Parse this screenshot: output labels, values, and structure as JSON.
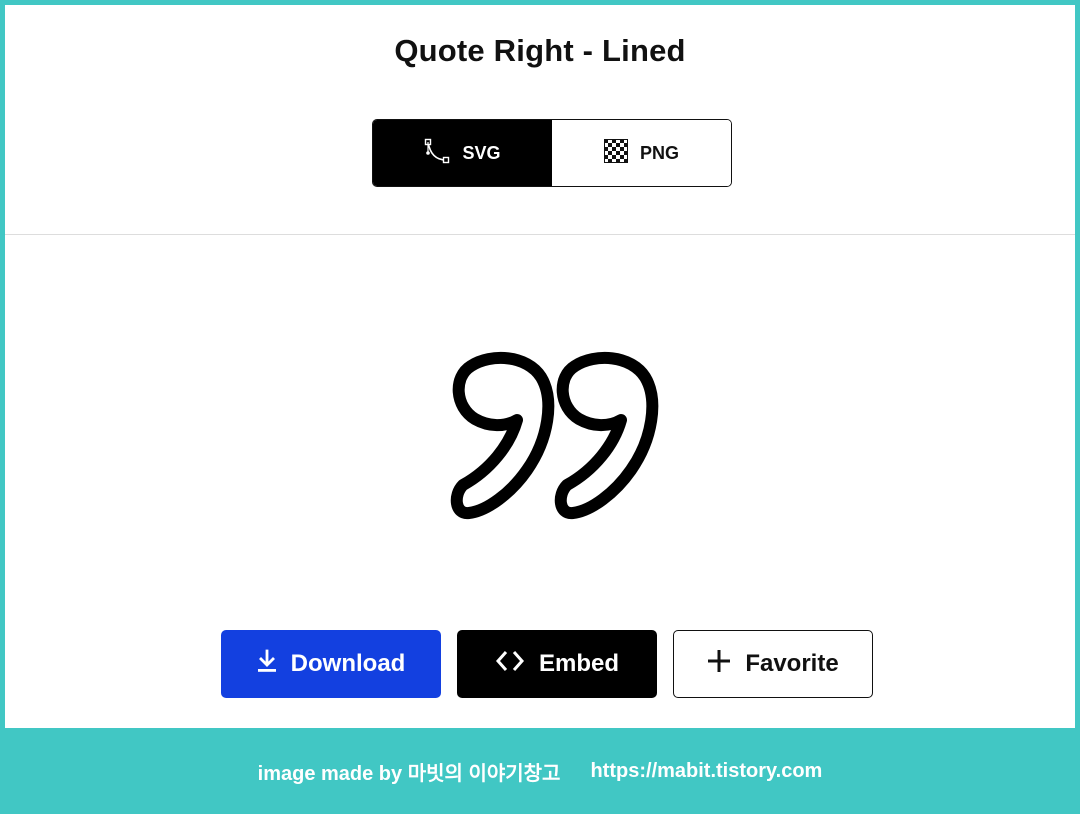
{
  "page": {
    "title": "Quote Right - Lined"
  },
  "format_toggle": {
    "svg_label": "SVG",
    "png_label": "PNG",
    "selected": "SVG"
  },
  "preview": {
    "icon": "quote-right-lined-icon"
  },
  "actions": {
    "download_label": "Download",
    "embed_label": "Embed",
    "favorite_label": "Favorite"
  },
  "footer": {
    "credit": "image made by 마빗의 이야기창고",
    "url": "https://mabit.tistory.com"
  },
  "colors": {
    "frame_border": "#41c7c4",
    "download_blue": "#1340e0",
    "dark": "#000000"
  }
}
